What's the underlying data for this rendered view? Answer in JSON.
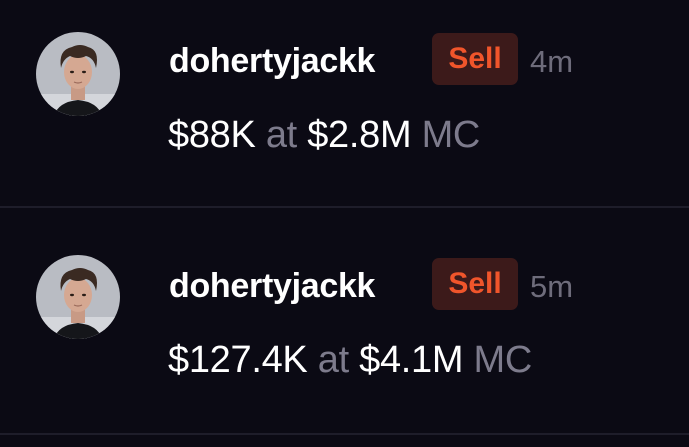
{
  "colors": {
    "background": "#0b0a14",
    "sell_badge_bg": "#3c1a1a",
    "sell_text": "#f0552b",
    "muted_text": "#7d7b8c"
  },
  "trades": [
    {
      "avatar_icon": "user-photo-avatar",
      "username": "dohertyjackk",
      "action": "Sell",
      "time": "4m",
      "amount": "$88K",
      "at_label": "at",
      "market_cap": "$2.8M",
      "mc_label": "MC"
    },
    {
      "avatar_icon": "user-photo-avatar",
      "username": "dohertyjackk",
      "action": "Sell",
      "time": "5m",
      "amount": "$127.4K",
      "at_label": "at",
      "market_cap": "$4.1M",
      "mc_label": "MC"
    }
  ]
}
